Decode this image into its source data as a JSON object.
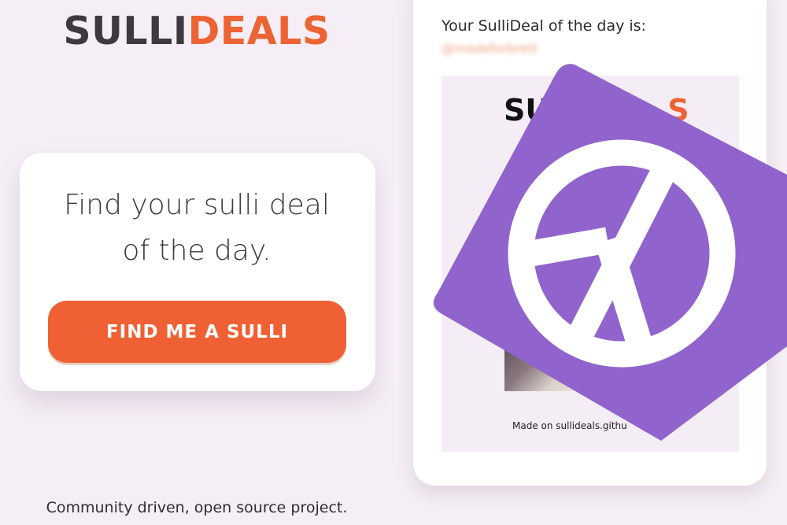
{
  "left": {
    "logo": {
      "part1": "SULLI",
      "part2": "DEALS"
    },
    "card": {
      "headline_line1": "Find your sulli deal",
      "headline_line2": "of the day.",
      "button_label": "FIND ME A SULLI"
    },
    "footer": "Community driven, open source project."
  },
  "right": {
    "deal_label": "Your SulliDeal of the day is:",
    "handle": "@madeforbrett",
    "preview": {
      "logo_part1": "SU",
      "logo_part2": "S",
      "footer": "Made on sullideals.githu"
    }
  },
  "colors": {
    "brand_orange": "#ec6433",
    "button_orange": "#ef6134",
    "badge_purple": "#9064cc",
    "background": "#f5eef5"
  },
  "icons": {
    "badge": "peace-sign-icon"
  }
}
